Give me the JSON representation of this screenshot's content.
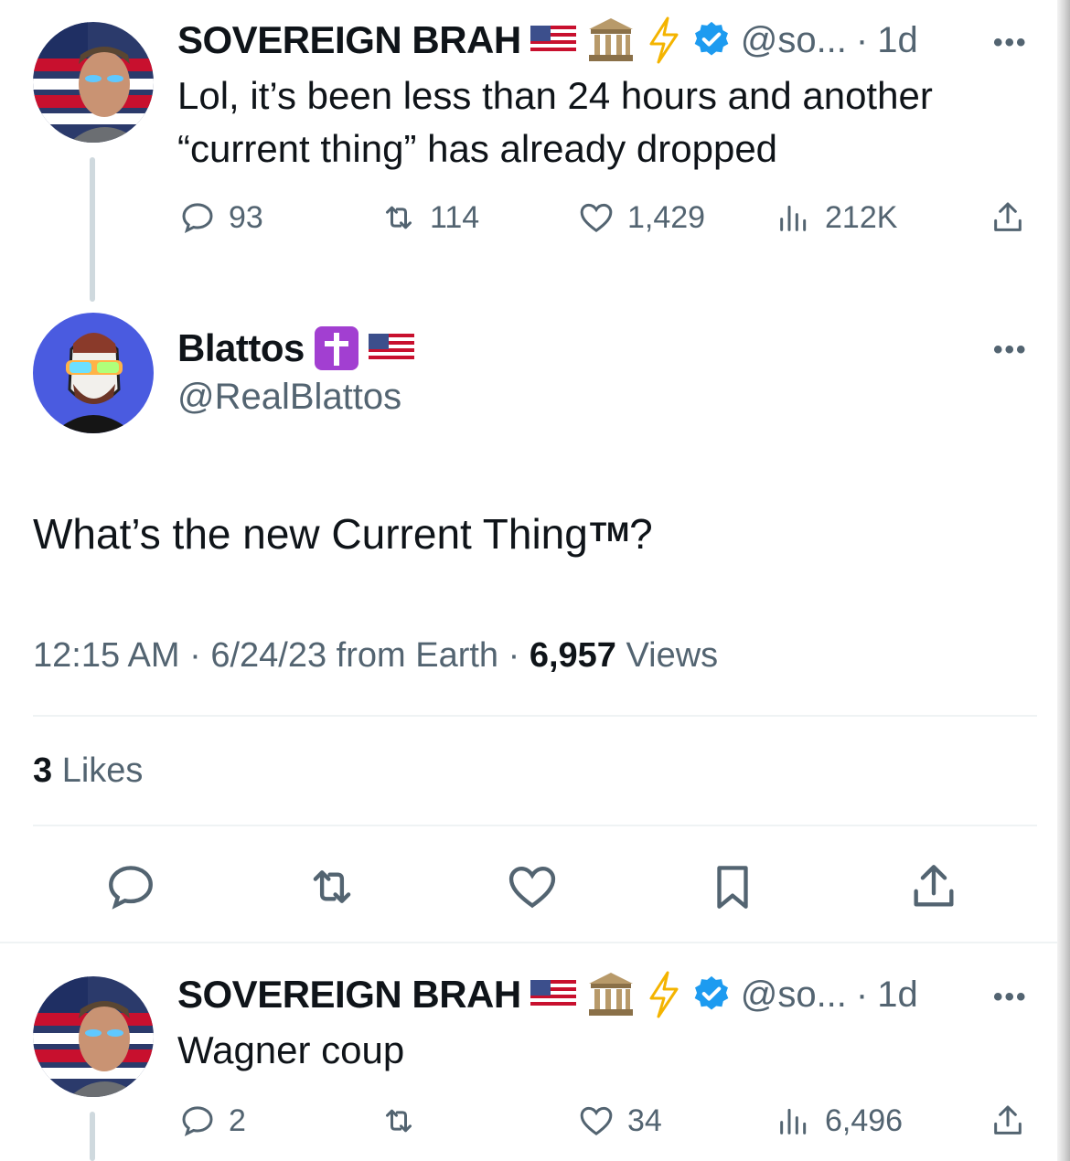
{
  "tweets": [
    {
      "display_name": "SOVEREIGN BRAH",
      "handle": "@so...",
      "separator": "·",
      "time": "1d",
      "text_line1": "Lol, it’s been less than 24 hours and another",
      "text_line2": "“current thing” has already dropped",
      "replies": "93",
      "retweets": "114",
      "likes": "1,429",
      "views": "212K"
    },
    {
      "display_name": "SOVEREIGN BRAH",
      "handle": "@so...",
      "separator": "·",
      "time": "1d",
      "text_line1": "Wagner coup",
      "replies": "2",
      "retweets": "",
      "likes": "34",
      "views": "6,496"
    }
  ],
  "main_tweet": {
    "display_name": "Blattos",
    "handle": "@RealBlattos",
    "text": "What’s the new Current Thing",
    "text_tm": "TM",
    "text_end": "?",
    "timestamp": "12:15 AM · 6/24/23 from Earth ·",
    "views_count": "6,957",
    "views_label": "Views",
    "likes_count": "3",
    "likes_label": "Likes"
  },
  "more_glyph": "•••",
  "colors": {
    "text": "#0f1419",
    "secondary": "#536471",
    "verified": "#1d9bf0",
    "divider": "#eff3f4",
    "thread_line": "#cfd9de"
  }
}
